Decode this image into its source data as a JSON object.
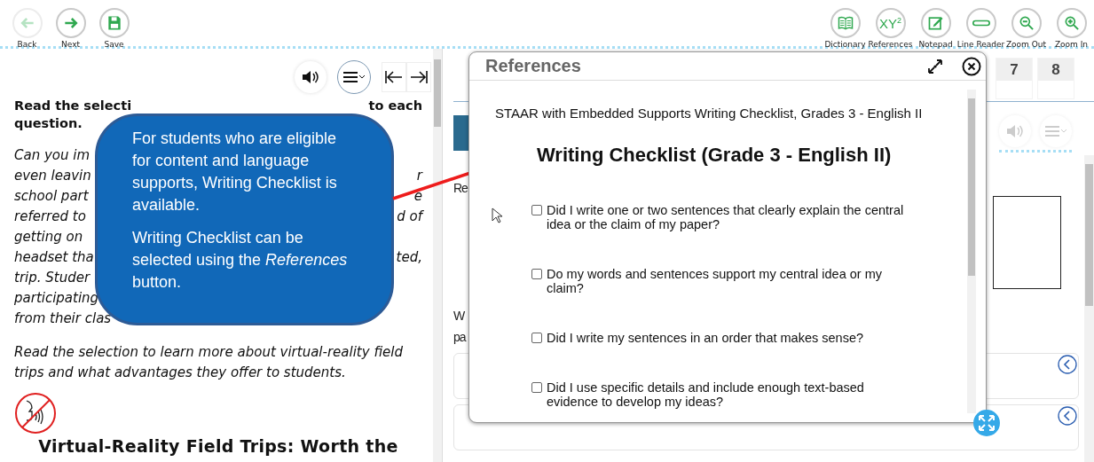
{
  "toolbar": {
    "left": [
      {
        "label": "Back",
        "disabled": true
      },
      {
        "label": "Next",
        "disabled": false
      },
      {
        "label": "Save",
        "disabled": false
      }
    ],
    "right": [
      {
        "label": "Dictionary",
        "disabled": false
      },
      {
        "label": "References",
        "glyph": "XY$^{2}$",
        "disabled": false
      },
      {
        "label": "Notepad",
        "disabled": false
      },
      {
        "label": "Line Reader",
        "disabled": false
      },
      {
        "label": "Zoom Out",
        "disabled": false
      },
      {
        "label": "Zoom In",
        "disabled": false
      }
    ]
  },
  "passage": {
    "intro_lines": [
      {
        "left": "Read the selecti",
        "right": "to each"
      },
      {
        "left": "question."
      }
    ],
    "italic_lines": [
      {
        "left": "Can you im"
      },
      {
        "left": "even leavin",
        "right": "r"
      },
      {
        "left": "school part",
        "right": "e"
      },
      {
        "left": "referred to",
        "right": "d of"
      },
      {
        "left": "getting on"
      },
      {
        "left": "headset tha",
        "right": "ted,"
      },
      {
        "left": "trip. Studer"
      },
      {
        "left": "participating"
      },
      {
        "left": "from their clas"
      }
    ],
    "closing": "Read the selection to learn more about virtual-reality field trips and what advantages they offer to students.",
    "title": "Virtual-Reality Field Trips: Worth the"
  },
  "question_panel": {
    "tabs": [
      {
        "label": "7",
        "selected": false
      },
      {
        "label": "8",
        "selected": false
      }
    ],
    "fragments": [
      "Re",
      "W",
      "pa"
    ]
  },
  "callout": {
    "paragraphs": [
      "For students who are eligible for content and language supports, Writing Checklist is available.",
      "Writing Checklist can be selected using the *References* button."
    ]
  },
  "references_dialog": {
    "title": "References",
    "source": "STAAR with Embedded Supports Writing Checklist, Grades 3 - English II",
    "heading": "Writing Checklist (Grade 3 - English II)",
    "items": [
      {
        "text": "Did I write one or two sentences that clearly explain the central idea or the claim of my paper?",
        "checked": false
      },
      {
        "text": "Do my words and sentences support my central idea or my claim?",
        "checked": false
      },
      {
        "text": "Did I write my sentences in an order that makes sense?",
        "checked": false
      },
      {
        "text": "Did I use specific details and include enough text-based evidence to develop my ideas?",
        "checked": false
      }
    ]
  }
}
